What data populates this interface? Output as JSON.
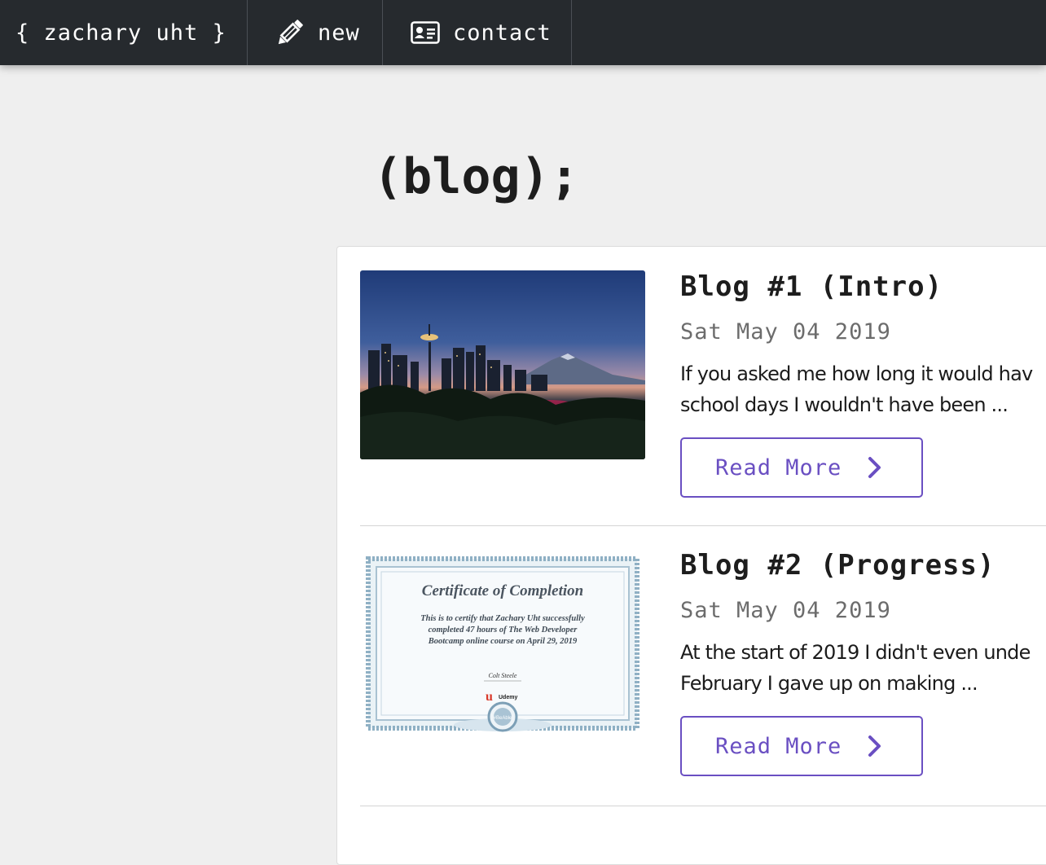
{
  "nav": {
    "brand": "{ zachary uht }",
    "new_label": "new",
    "contact_label": "contact"
  },
  "page": {
    "title": "(blog);"
  },
  "posts": [
    {
      "title": "Blog #1 (Intro)",
      "date": "Sat May 04 2019",
      "excerpt_line1": "If you asked me how long it would hav",
      "excerpt_line2": "school days I wouldn't have been ...",
      "read_more": "Read More",
      "image": "seattle-skyline-photo"
    },
    {
      "title": "Blog #2 (Progress)",
      "date": "Sat May 04 2019",
      "excerpt_line1": "At the start of 2019 I didn't even unde",
      "excerpt_line2": "February I gave up on making ...",
      "read_more": "Read More",
      "image": "udemy-certificate-image",
      "certificate": {
        "heading": "Certificate of Completion",
        "body_line1": "This is to certify that Zachary Uht successfully",
        "body_line2": "completed 47 hours of The Web Developer",
        "body_line3": "Bootcamp online course on April 29, 2019",
        "signature": "Colt Steele",
        "brand": "Udemy",
        "seal": "#BeAble"
      }
    }
  ],
  "colors": {
    "navbar": "#262a2e",
    "accent": "#6a4fc2",
    "background": "#efefef"
  }
}
